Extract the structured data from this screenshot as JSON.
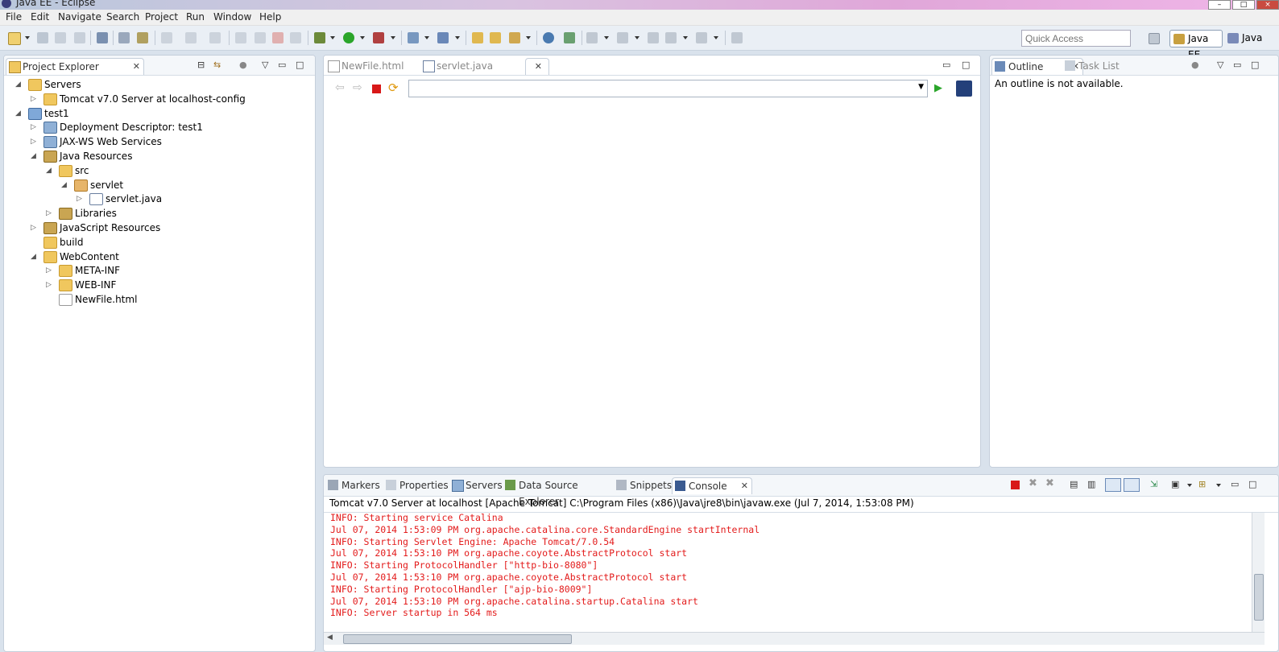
{
  "window": {
    "title": "Java EE - Eclipse"
  },
  "menu": [
    "File",
    "Edit",
    "Navigate",
    "Search",
    "Project",
    "Run",
    "Window",
    "Help"
  ],
  "toolbar": {
    "quick_access_placeholder": "Quick Access"
  },
  "perspectives": [
    "Java EE",
    "Java"
  ],
  "project_explorer": {
    "title": "Project Explorer",
    "tree": [
      {
        "label": "Servers",
        "level": 0,
        "expanded": true,
        "icon": "servers-folder-icon"
      },
      {
        "label": "Tomcat v7.0 Server at localhost-config",
        "level": 1,
        "expanded": false,
        "icon": "folder-icon"
      },
      {
        "label": "test1",
        "level": 0,
        "expanded": true,
        "icon": "web-project-icon"
      },
      {
        "label": "Deployment Descriptor: test1",
        "level": 1,
        "expanded": false,
        "icon": "descriptor-icon"
      },
      {
        "label": "JAX-WS Web Services",
        "level": 1,
        "expanded": false,
        "icon": "webservices-icon"
      },
      {
        "label": "Java Resources",
        "level": 1,
        "expanded": true,
        "icon": "java-resources-icon"
      },
      {
        "label": "src",
        "level": 2,
        "expanded": true,
        "icon": "source-folder-icon"
      },
      {
        "label": "servlet",
        "level": 3,
        "expanded": true,
        "icon": "package-icon"
      },
      {
        "label": "servlet.java",
        "level": 4,
        "expanded": false,
        "icon": "java-file-icon"
      },
      {
        "label": "Libraries",
        "level": 2,
        "expanded": false,
        "icon": "libraries-icon"
      },
      {
        "label": "JavaScript Resources",
        "level": 1,
        "expanded": false,
        "icon": "js-resources-icon"
      },
      {
        "label": "build",
        "level": 1,
        "expanded": null,
        "icon": "folder-icon"
      },
      {
        "label": "WebContent",
        "level": 1,
        "expanded": true,
        "icon": "folder-icon"
      },
      {
        "label": "META-INF",
        "level": 2,
        "expanded": false,
        "icon": "folder-icon"
      },
      {
        "label": "WEB-INF",
        "level": 2,
        "expanded": false,
        "icon": "folder-icon"
      },
      {
        "label": "NewFile.html",
        "level": 2,
        "expanded": null,
        "icon": "html-file-icon"
      }
    ]
  },
  "editor": {
    "tabs": [
      "NewFile.html",
      "servlet.java"
    ],
    "url_value": ""
  },
  "outline": {
    "tabs": [
      "Outline",
      "Task List"
    ],
    "message": "An outline is not available."
  },
  "bottom": {
    "tabs": [
      "Markers",
      "Properties",
      "Servers",
      "Data Source Explorer",
      "Snippets",
      "Console"
    ],
    "console_header": "Tomcat v7.0 Server at localhost [Apache Tomcat] C:\\Program Files (x86)\\Java\\jre8\\bin\\javaw.exe (Jul 7, 2014, 1:53:08 PM)",
    "console_lines": [
      "INFO: Starting service Catalina",
      "Jul 07, 2014 1:53:09 PM org.apache.catalina.core.StandardEngine startInternal",
      "INFO: Starting Servlet Engine: Apache Tomcat/7.0.54",
      "Jul 07, 2014 1:53:10 PM org.apache.coyote.AbstractProtocol start",
      "INFO: Starting ProtocolHandler [\"http-bio-8080\"]",
      "Jul 07, 2014 1:53:10 PM org.apache.coyote.AbstractProtocol start",
      "INFO: Starting ProtocolHandler [\"ajp-bio-8009\"]",
      "Jul 07, 2014 1:53:10 PM org.apache.catalina.startup.Catalina start",
      "INFO: Server startup in 564 ms"
    ],
    "console_color": "#e31b1b"
  }
}
